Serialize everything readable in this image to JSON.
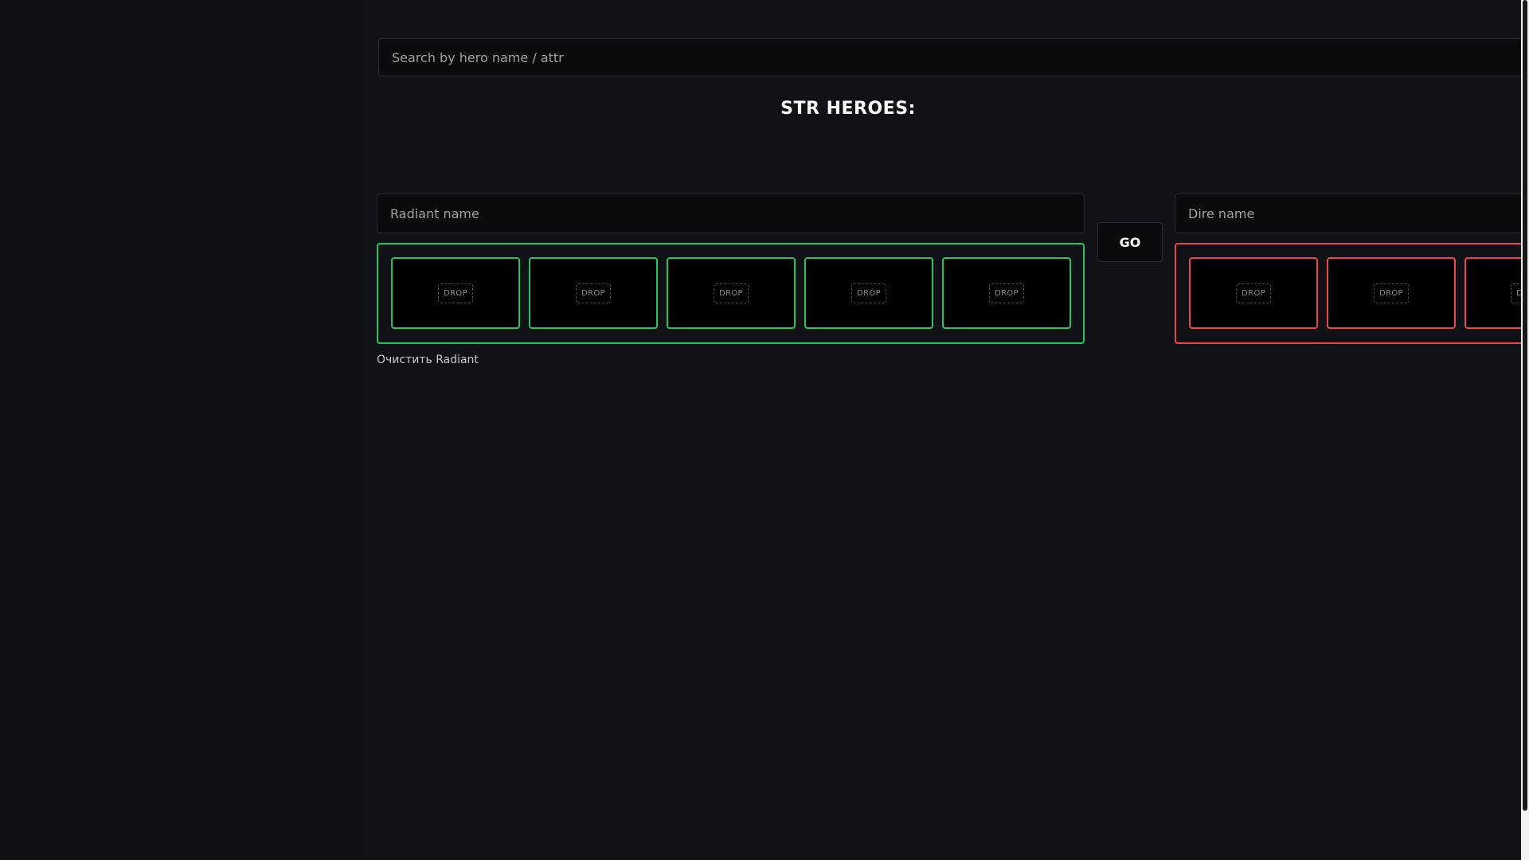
{
  "search": {
    "placeholder": "Search by hero name / attr"
  },
  "section": {
    "title": "STR HEROES:"
  },
  "radiant": {
    "name_placeholder": "Radiant name",
    "slots": [
      "DROP",
      "DROP",
      "DROP",
      "DROP",
      "DROP"
    ],
    "clear_label": "Очистить Radiant",
    "accent_color": "#22c55e"
  },
  "go": {
    "label": "GO"
  },
  "dire": {
    "name_placeholder": "Dire name",
    "slots": [
      "DROP",
      "DROP",
      "D"
    ],
    "accent_color": "#ef4444"
  }
}
